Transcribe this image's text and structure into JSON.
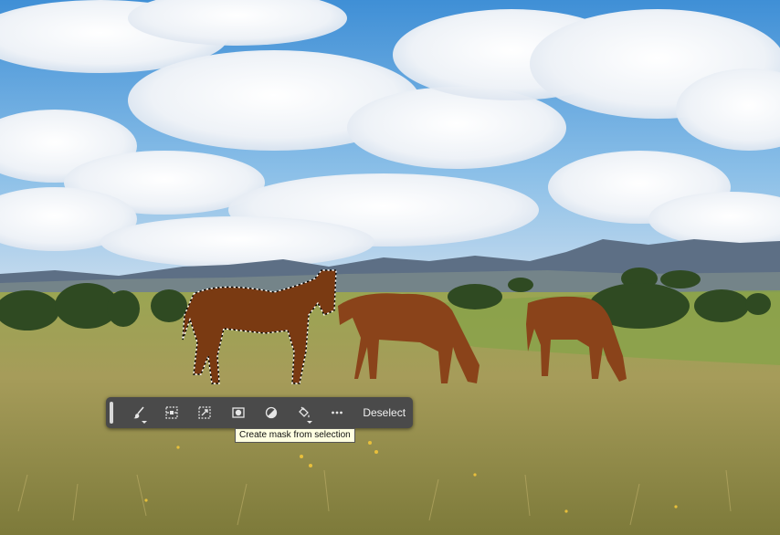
{
  "canvas": {
    "image_subject": "three-horses-grazing-on-grassland"
  },
  "context_toolbar": {
    "tools": [
      {
        "name": "brush-tool-button",
        "icon": "brush-icon",
        "has_submenu": true
      },
      {
        "name": "modify-selection-button",
        "icon": "modify-selection-icon",
        "has_submenu": false
      },
      {
        "name": "transform-selection-button",
        "icon": "transform-selection-icon",
        "has_submenu": false
      },
      {
        "name": "create-mask-button",
        "icon": "mask-icon",
        "has_submenu": false
      },
      {
        "name": "adjustment-button",
        "icon": "half-circle-icon",
        "has_submenu": false
      },
      {
        "name": "fill-button",
        "icon": "paint-bucket-icon",
        "has_submenu": true
      },
      {
        "name": "more-options-button",
        "icon": "more-icon",
        "has_submenu": false
      }
    ],
    "deselect_label": "Deselect"
  },
  "tooltip": {
    "text": "Create mask from selection"
  },
  "colors": {
    "toolbar_bg": "#4a4a4a",
    "tooltip_bg": "#ffffe1",
    "icon": "#e6e6e6"
  }
}
